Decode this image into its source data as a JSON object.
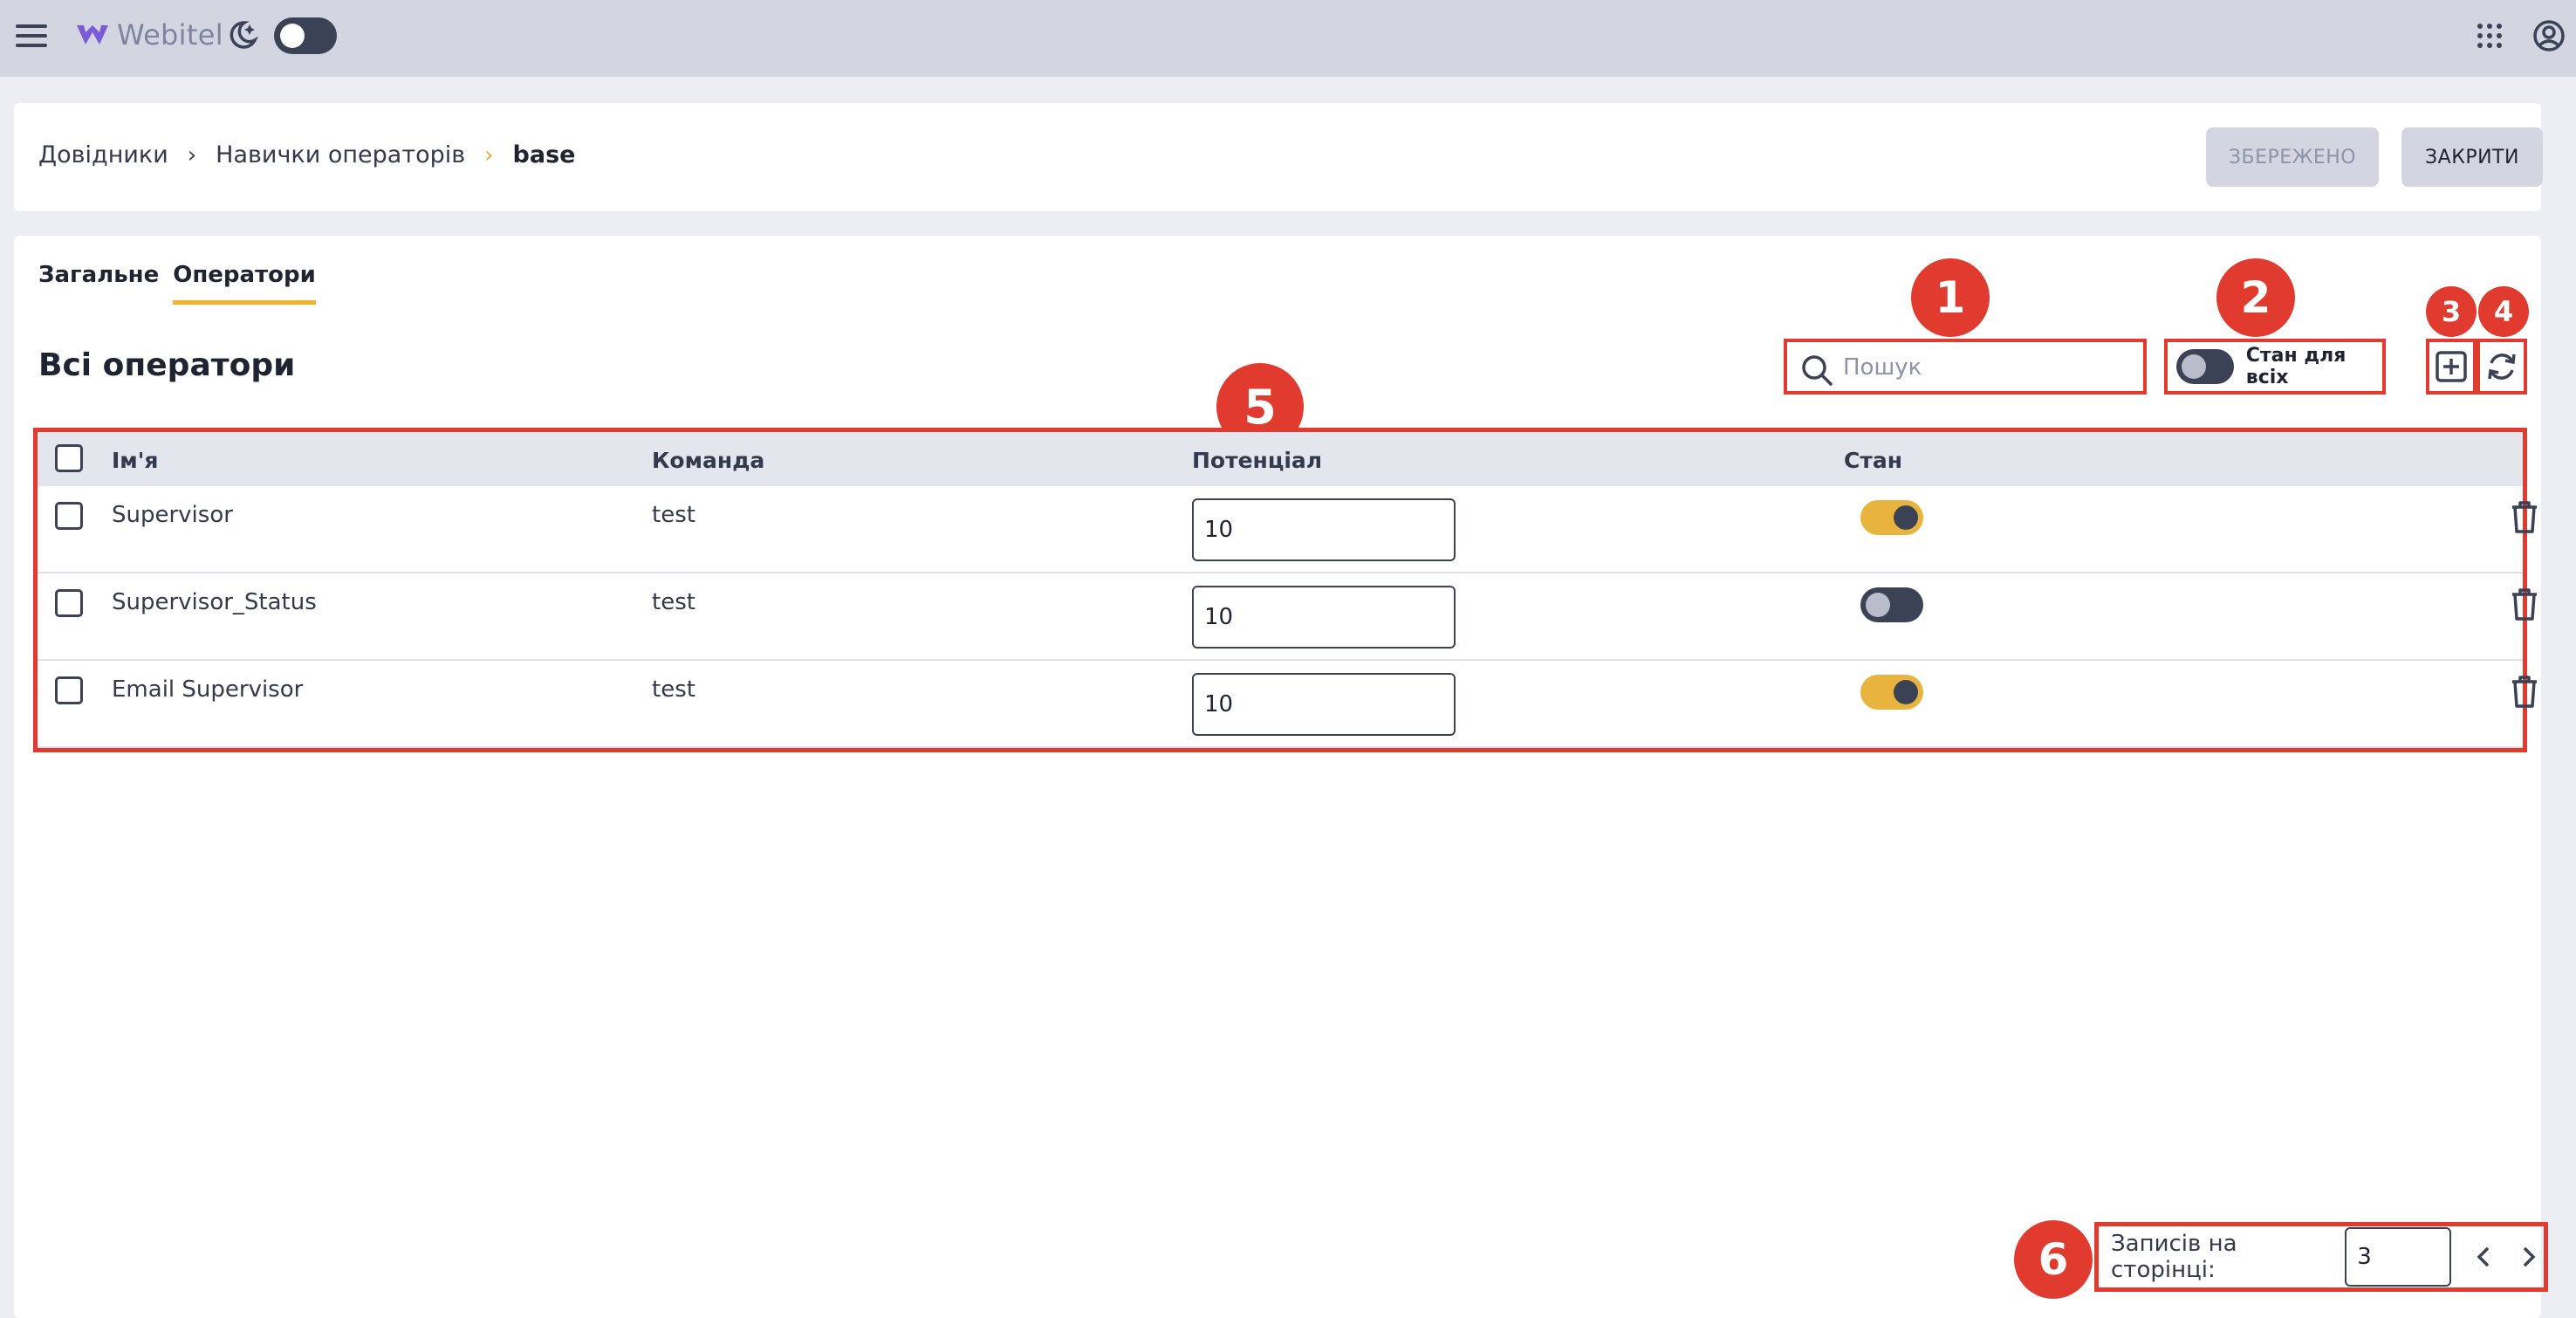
{
  "topbar": {
    "logo_text": "Webitel",
    "icons": [
      "menu-icon",
      "moon-icon",
      "apps-grid-icon",
      "account-icon"
    ],
    "theme_toggle": "off"
  },
  "breadcrumb": {
    "items": [
      "Довідники",
      "Навички операторів",
      "base"
    ]
  },
  "header_actions": {
    "saved_label": "ЗБЕРЕЖЕНО",
    "close_label": "ЗАКРИТИ"
  },
  "tabs": [
    {
      "label": "Загальне",
      "active": false
    },
    {
      "label": "Оператори",
      "active": true
    }
  ],
  "section": {
    "title": "Всі оператори"
  },
  "search": {
    "placeholder": "Пошук",
    "value": ""
  },
  "state_all": {
    "label": "Стан для всіх",
    "on": false
  },
  "table": {
    "columns": [
      "Ім'я",
      "Команда",
      "Потенціал",
      "Стан"
    ],
    "rows": [
      {
        "name": "Supervisor",
        "team": "test",
        "capacity": "10",
        "state_on": true
      },
      {
        "name": "Supervisor_Status",
        "team": "test",
        "capacity": "10",
        "state_on": false
      },
      {
        "name": "Email Supervisor",
        "team": "test",
        "capacity": "10",
        "state_on": true
      }
    ]
  },
  "pagination": {
    "label": "Записів на сторінці:",
    "per_page": "3"
  },
  "annotations": [
    "1",
    "2",
    "3",
    "4",
    "5",
    "6"
  ],
  "colors": {
    "annotation_red": "#e03b2e",
    "accent_yellow": "#e8b43e",
    "dark_slate": "#3b4256",
    "topbar_bg": "#d3d6e1"
  }
}
